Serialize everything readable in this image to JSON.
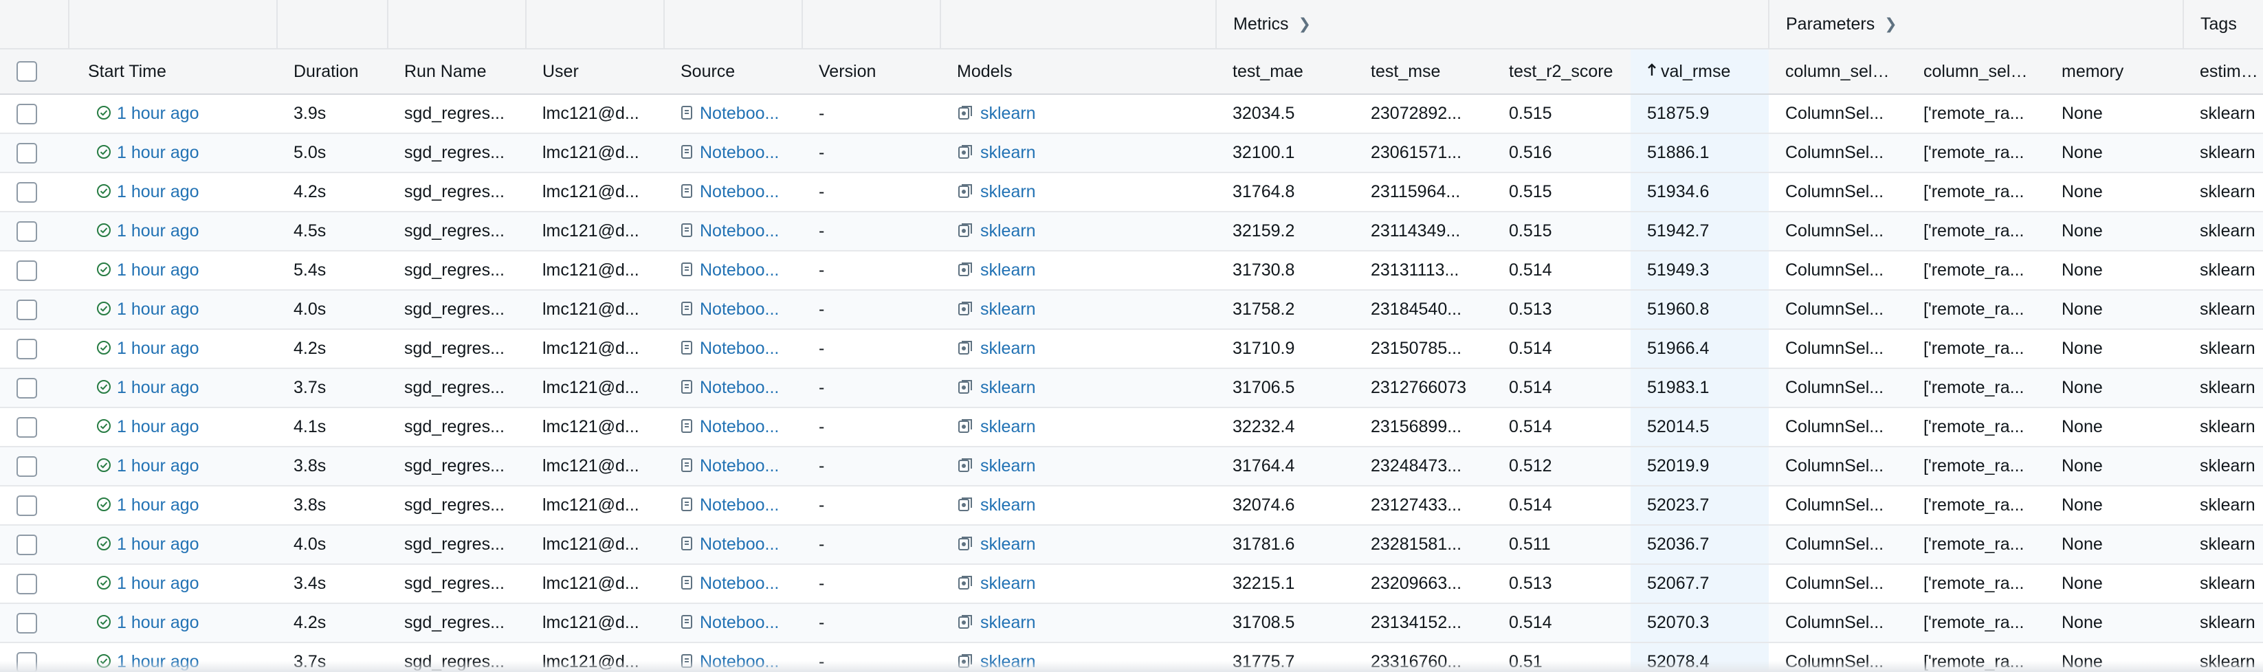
{
  "groups": {
    "metrics": "Metrics",
    "parameters": "Parameters",
    "tags": "Tags"
  },
  "columns": {
    "start_time": "Start Time",
    "duration": "Duration",
    "run_name": "Run Name",
    "user": "User",
    "source": "Source",
    "version": "Version",
    "models": "Models",
    "test_mae": "test_mae",
    "test_mse": "test_mse",
    "test_r2_score": "test_r2_score",
    "val_rmse": "val_rmse",
    "column_selector_1": "column_selector",
    "column_selector_2": "column_selector",
    "memory": "memory",
    "estimator": "estimator"
  },
  "sort": {
    "column": "val_rmse",
    "direction": "ascending",
    "icon": "arrow-up-icon"
  },
  "colors": {
    "link": "#2272b4",
    "success": "#277c43",
    "sorted_bg": "#eef6fd"
  },
  "rows": [
    {
      "start_time": "1 hour ago",
      "duration": "3.9s",
      "run_name": "sgd_regres...",
      "user": "lmc121@d...",
      "source": "Noteboo...",
      "version": "-",
      "models": "sklearn",
      "test_mae": "32034.5",
      "test_mse": "23072892...",
      "test_r2_score": "0.515",
      "val_rmse": "51875.9",
      "column_selector_1": "ColumnSel...",
      "column_selector_2": "['remote_ra...",
      "memory": "None",
      "estimator": "sklearn"
    },
    {
      "start_time": "1 hour ago",
      "duration": "5.0s",
      "run_name": "sgd_regres...",
      "user": "lmc121@d...",
      "source": "Noteboo...",
      "version": "-",
      "models": "sklearn",
      "test_mae": "32100.1",
      "test_mse": "23061571...",
      "test_r2_score": "0.516",
      "val_rmse": "51886.1",
      "column_selector_1": "ColumnSel...",
      "column_selector_2": "['remote_ra...",
      "memory": "None",
      "estimator": "sklearn"
    },
    {
      "start_time": "1 hour ago",
      "duration": "4.2s",
      "run_name": "sgd_regres...",
      "user": "lmc121@d...",
      "source": "Noteboo...",
      "version": "-",
      "models": "sklearn",
      "test_mae": "31764.8",
      "test_mse": "23115964...",
      "test_r2_score": "0.515",
      "val_rmse": "51934.6",
      "column_selector_1": "ColumnSel...",
      "column_selector_2": "['remote_ra...",
      "memory": "None",
      "estimator": "sklearn"
    },
    {
      "start_time": "1 hour ago",
      "duration": "4.5s",
      "run_name": "sgd_regres...",
      "user": "lmc121@d...",
      "source": "Noteboo...",
      "version": "-",
      "models": "sklearn",
      "test_mae": "32159.2",
      "test_mse": "23114349...",
      "test_r2_score": "0.515",
      "val_rmse": "51942.7",
      "column_selector_1": "ColumnSel...",
      "column_selector_2": "['remote_ra...",
      "memory": "None",
      "estimator": "sklearn"
    },
    {
      "start_time": "1 hour ago",
      "duration": "5.4s",
      "run_name": "sgd_regres...",
      "user": "lmc121@d...",
      "source": "Noteboo...",
      "version": "-",
      "models": "sklearn",
      "test_mae": "31730.8",
      "test_mse": "23131113...",
      "test_r2_score": "0.514",
      "val_rmse": "51949.3",
      "column_selector_1": "ColumnSel...",
      "column_selector_2": "['remote_ra...",
      "memory": "None",
      "estimator": "sklearn"
    },
    {
      "start_time": "1 hour ago",
      "duration": "4.0s",
      "run_name": "sgd_regres...",
      "user": "lmc121@d...",
      "source": "Noteboo...",
      "version": "-",
      "models": "sklearn",
      "test_mae": "31758.2",
      "test_mse": "23184540...",
      "test_r2_score": "0.513",
      "val_rmse": "51960.8",
      "column_selector_1": "ColumnSel...",
      "column_selector_2": "['remote_ra...",
      "memory": "None",
      "estimator": "sklearn"
    },
    {
      "start_time": "1 hour ago",
      "duration": "4.2s",
      "run_name": "sgd_regres...",
      "user": "lmc121@d...",
      "source": "Noteboo...",
      "version": "-",
      "models": "sklearn",
      "test_mae": "31710.9",
      "test_mse": "23150785...",
      "test_r2_score": "0.514",
      "val_rmse": "51966.4",
      "column_selector_1": "ColumnSel...",
      "column_selector_2": "['remote_ra...",
      "memory": "None",
      "estimator": "sklearn"
    },
    {
      "start_time": "1 hour ago",
      "duration": "3.7s",
      "run_name": "sgd_regres...",
      "user": "lmc121@d...",
      "source": "Noteboo...",
      "version": "-",
      "models": "sklearn",
      "test_mae": "31706.5",
      "test_mse": "2312766073",
      "test_r2_score": "0.514",
      "val_rmse": "51983.1",
      "column_selector_1": "ColumnSel...",
      "column_selector_2": "['remote_ra...",
      "memory": "None",
      "estimator": "sklearn"
    },
    {
      "start_time": "1 hour ago",
      "duration": "4.1s",
      "run_name": "sgd_regres...",
      "user": "lmc121@d...",
      "source": "Noteboo...",
      "version": "-",
      "models": "sklearn",
      "test_mae": "32232.4",
      "test_mse": "23156899...",
      "test_r2_score": "0.514",
      "val_rmse": "52014.5",
      "column_selector_1": "ColumnSel...",
      "column_selector_2": "['remote_ra...",
      "memory": "None",
      "estimator": "sklearn"
    },
    {
      "start_time": "1 hour ago",
      "duration": "3.8s",
      "run_name": "sgd_regres...",
      "user": "lmc121@d...",
      "source": "Noteboo...",
      "version": "-",
      "models": "sklearn",
      "test_mae": "31764.4",
      "test_mse": "23248473...",
      "test_r2_score": "0.512",
      "val_rmse": "52019.9",
      "column_selector_1": "ColumnSel...",
      "column_selector_2": "['remote_ra...",
      "memory": "None",
      "estimator": "sklearn"
    },
    {
      "start_time": "1 hour ago",
      "duration": "3.8s",
      "run_name": "sgd_regres...",
      "user": "lmc121@d...",
      "source": "Noteboo...",
      "version": "-",
      "models": "sklearn",
      "test_mae": "32074.6",
      "test_mse": "23127433...",
      "test_r2_score": "0.514",
      "val_rmse": "52023.7",
      "column_selector_1": "ColumnSel...",
      "column_selector_2": "['remote_ra...",
      "memory": "None",
      "estimator": "sklearn"
    },
    {
      "start_time": "1 hour ago",
      "duration": "4.0s",
      "run_name": "sgd_regres...",
      "user": "lmc121@d...",
      "source": "Noteboo...",
      "version": "-",
      "models": "sklearn",
      "test_mae": "31781.6",
      "test_mse": "23281581...",
      "test_r2_score": "0.511",
      "val_rmse": "52036.7",
      "column_selector_1": "ColumnSel...",
      "column_selector_2": "['remote_ra...",
      "memory": "None",
      "estimator": "sklearn"
    },
    {
      "start_time": "1 hour ago",
      "duration": "3.4s",
      "run_name": "sgd_regres...",
      "user": "lmc121@d...",
      "source": "Noteboo...",
      "version": "-",
      "models": "sklearn",
      "test_mae": "32215.1",
      "test_mse": "23209663...",
      "test_r2_score": "0.513",
      "val_rmse": "52067.7",
      "column_selector_1": "ColumnSel...",
      "column_selector_2": "['remote_ra...",
      "memory": "None",
      "estimator": "sklearn"
    },
    {
      "start_time": "1 hour ago",
      "duration": "4.2s",
      "run_name": "sgd_regres...",
      "user": "lmc121@d...",
      "source": "Noteboo...",
      "version": "-",
      "models": "sklearn",
      "test_mae": "31708.5",
      "test_mse": "23134152...",
      "test_r2_score": "0.514",
      "val_rmse": "52070.3",
      "column_selector_1": "ColumnSel...",
      "column_selector_2": "['remote_ra...",
      "memory": "None",
      "estimator": "sklearn"
    },
    {
      "start_time": "1 hour ago",
      "duration": "3.7s",
      "run_name": "sgd_regres...",
      "user": "lmc121@d...",
      "source": "Noteboo...",
      "version": "-",
      "models": "sklearn",
      "test_mae": "31775.7",
      "test_mse": "23316760...",
      "test_r2_score": "0.51",
      "val_rmse": "52078.4",
      "column_selector_1": "ColumnSel...",
      "column_selector_2": "['remote_ra...",
      "memory": "None",
      "estimator": "sklearn"
    }
  ]
}
